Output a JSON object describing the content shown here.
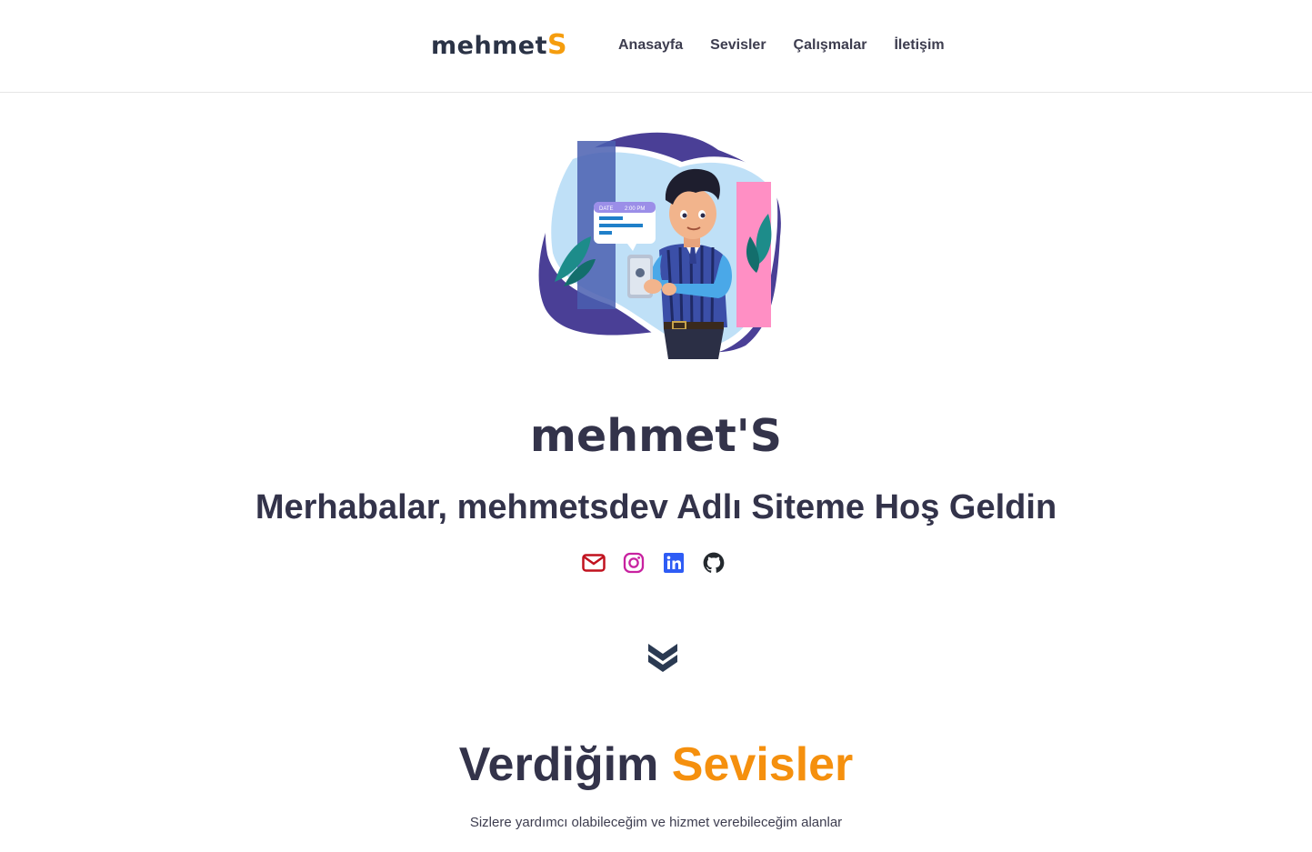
{
  "brand": {
    "logo_main": "mehmet",
    "logo_accent": "S",
    "accent_color": "#f59d0e"
  },
  "nav": {
    "items": [
      {
        "label": "Anasayfa"
      },
      {
        "label": "Sevisler"
      },
      {
        "label": "Çalışmalar"
      },
      {
        "label": "İletişim"
      }
    ]
  },
  "hero": {
    "illustration": "person-with-phone-illustration",
    "illustration_badge": {
      "date_label": "DATE",
      "time_label": "2:00 PM"
    },
    "name": "mehmet'S",
    "welcome": "Merhabalar, mehmetsdev Adlı Siteme Hoş Geldin",
    "socials": [
      {
        "icon": "mail-icon",
        "color": "#c1121f"
      },
      {
        "icon": "instagram-icon",
        "color": "#c822a0"
      },
      {
        "icon": "linkedin-icon",
        "color": "#2e5cf5"
      },
      {
        "icon": "github-icon",
        "color": "#24292e"
      }
    ],
    "scroll_icon": "double-chevron-down-icon"
  },
  "services": {
    "title_main": "Verdiğim",
    "title_accent": "Sevisler",
    "subtitle": "Sizlere yardımcı olabileceğim ve hizmet verebileceğim alanlar"
  }
}
